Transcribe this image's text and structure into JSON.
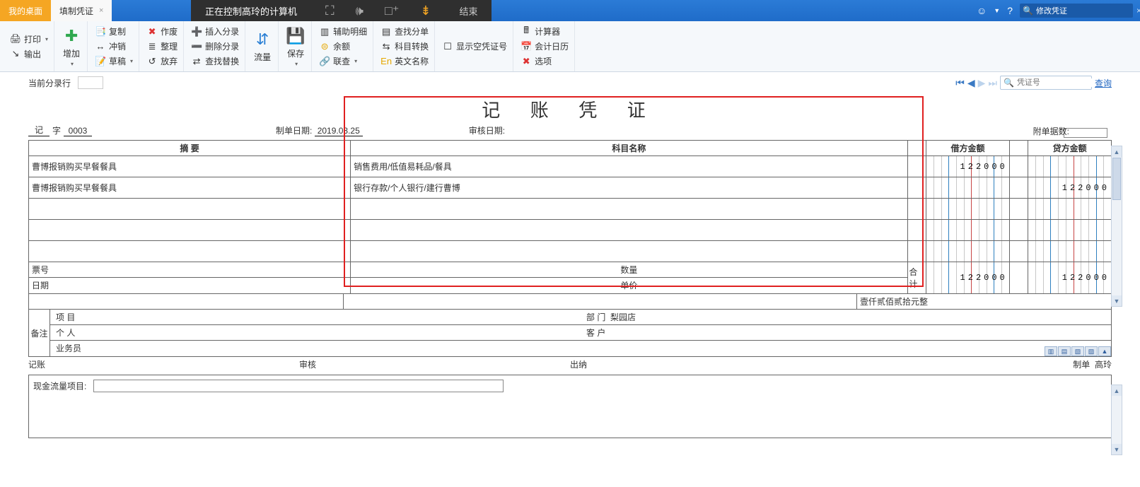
{
  "topbar": {
    "tab_home": "我的桌面",
    "tab_active": "填制凭证",
    "remote_text": "正在控制高玲的计算机",
    "remote_end": "结束",
    "search_value": "修改凭证"
  },
  "ribbon": {
    "print": "打印",
    "output": "输出",
    "add": "增加",
    "copy": "复制",
    "offset": "冲销",
    "draft": "草稿",
    "invalid": "作废",
    "sort": "整理",
    "abandon": "放弃",
    "insert_entry": "插入分录",
    "delete_entry": "删除分录",
    "find_replace": "查找替换",
    "flow": "流量",
    "save": "保存",
    "assist_detail": "辅助明细",
    "balance": "余额",
    "relate": "联查",
    "find_divide": "查找分单",
    "subject_switch": "科目转换",
    "english_name": "英文名称",
    "show_empty_voucher": "显示空凭证号",
    "calculator": "计算器",
    "acct_calendar": "会计日历",
    "options": "选项"
  },
  "subbar": {
    "current_entry": "当前分录行",
    "voucher_no_placeholder": "凭证号",
    "query": "查询"
  },
  "voucher": {
    "title": "记 账 凭 证",
    "prefix": "记",
    "zi": "字",
    "number": "0003",
    "make_date_label": "制单日期:",
    "make_date": "2019.03.25",
    "audit_date_label": "审核日期:",
    "attach_label": "附单据数:",
    "headers": {
      "summary": "摘 要",
      "subject": "科目名称",
      "debit": "借方金额",
      "credit": "贷方金额"
    },
    "rows": [
      {
        "summary": "曹博报销购买早餐餐具",
        "subject": "销售费用/低值易耗品/餐具",
        "debit": "122000",
        "credit": ""
      },
      {
        "summary": "曹博报销购买早餐餐具",
        "subject": "银行存款/个人银行/建行曹博",
        "debit": "",
        "credit": "122000"
      },
      {
        "summary": "",
        "subject": "",
        "debit": "",
        "credit": ""
      },
      {
        "summary": "",
        "subject": "",
        "debit": "",
        "credit": ""
      },
      {
        "summary": "",
        "subject": "",
        "debit": "",
        "credit": ""
      }
    ],
    "total_label": "合 计",
    "total_debit": "122000",
    "total_credit": "122000",
    "total_text": "壹仟贰佰贰拾元整",
    "ticket_no": "票号",
    "date_lbl": "日期",
    "qty": "数量",
    "price": "单价",
    "remark": "备注",
    "project": "项 目",
    "person": "个 人",
    "bizman": "业务员",
    "dept": "部 门",
    "dept_val": "梨园店",
    "customer": "客 户",
    "sign_bookkeep": "记账",
    "sign_audit": "审核",
    "sign_cashier": "出纳",
    "sign_make": "制单",
    "sign_make_val": "高玲",
    "cashflow_label": "现金流量项目:"
  }
}
